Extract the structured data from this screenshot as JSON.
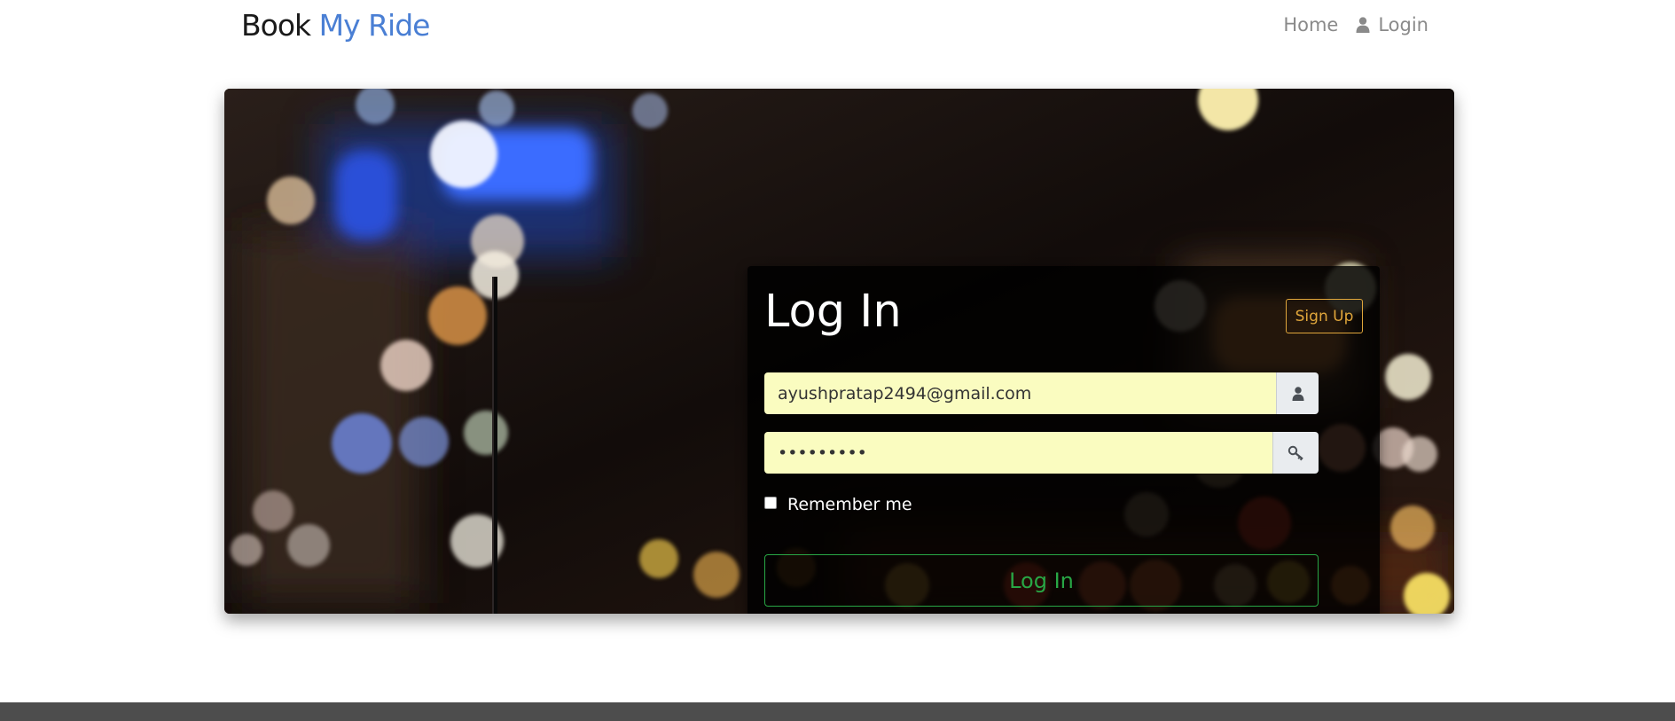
{
  "navbar": {
    "brand_part1": "Book",
    "brand_part2": "My Ride",
    "home_label": "Home",
    "login_label": "Login",
    "login_icon": "user-icon"
  },
  "login_card": {
    "title": "Log In",
    "signup_label": "Sign Up",
    "email_value": "ayushpratap2494@gmail.com",
    "email_icon": "user-icon",
    "password_value": "•••••••••",
    "password_icon": "key-icon",
    "remember_label": "Remember me",
    "remember_checked": false,
    "submit_label": "Log In"
  },
  "hero": {
    "background": "night-city-bokeh-photo"
  },
  "colors": {
    "brand_accent": "#4a7fd4",
    "signup_accent": "#e0a63b",
    "submit_accent": "#28a745",
    "input_fill": "#fafcc0",
    "footer": "#4d4d4d"
  }
}
